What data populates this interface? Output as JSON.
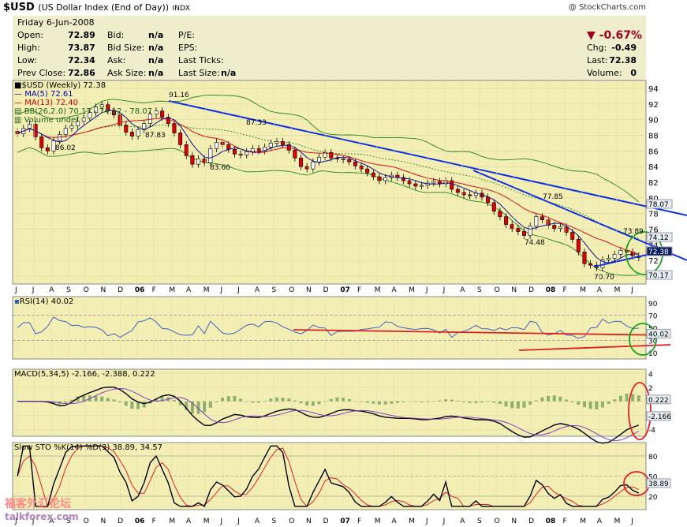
{
  "header": {
    "symbol": "$USD",
    "name": "(US Dollar Index (End of Day))",
    "exchange": "INDX",
    "copyright": "@ StockCharts.com"
  },
  "quote": {
    "date": "Friday   6-Jun-2008",
    "rows": [
      {
        "k1": "Open:",
        "v1": "72.89",
        "k2": "Bid:",
        "v2": "n/a",
        "k3": "P/E:"
      },
      {
        "k1": "High:",
        "v1": "73.87",
        "k2": "Bid Size:",
        "v2": "n/a",
        "k3": "EPS:"
      },
      {
        "k1": "Low:",
        "v1": "72.34",
        "k2": "Ask:",
        "v2": "n/a",
        "k3": "Last Ticks:"
      },
      {
        "k1": "Prev Close:",
        "v1": "72.86",
        "k2": "Ask Size:",
        "v2": "n/a",
        "k3": "Last Size:",
        "v3": "n/a"
      }
    ],
    "pct_change": "-0.67%",
    "right": [
      {
        "k": "Chg:",
        "v": "-0.49"
      },
      {
        "k": "Last:",
        "v": "72.38"
      },
      {
        "k": "Volume:",
        "v": "0"
      }
    ]
  },
  "legend": {
    "main": "$USD (Weekly) 72.38",
    "ma5": "MA(5) 72.61",
    "ma13": "MA(13) 72.40",
    "bb": "BB(26,2.0) 70.17 - 74.12 - 78.07",
    "vol": "Volume undef",
    "rsi": "RSI(14) 40.02",
    "macd": "MACD(5,34,5) -2.166, -2.388, 0.222",
    "sto": "Slow STO %K(14) %D(3) 38.89, 34.57"
  },
  "watermark": {
    "cn": "福客外汇论坛",
    "en": "talkforex.com"
  },
  "chart_data": [
    {
      "type": "candlestick",
      "title": "$USD (Weekly) 72.38",
      "x_labels": [
        "J",
        "J",
        "A",
        "S",
        "O",
        "N",
        "D",
        "06",
        "F",
        "M",
        "A",
        "M",
        "J",
        "J",
        "A",
        "S",
        "O",
        "N",
        "D",
        "07",
        "F",
        "M",
        "A",
        "M",
        "J",
        "J",
        "A",
        "S",
        "O",
        "N",
        "D",
        "08",
        "F",
        "M",
        "A",
        "M",
        "J"
      ],
      "y_ticks": [
        70,
        72,
        74,
        76,
        78,
        80,
        82,
        84,
        86,
        88,
        90,
        92,
        94
      ],
      "ylim": [
        69,
        95
      ],
      "annotations": [
        "86.02",
        "91.16",
        "87.83",
        "83.60",
        "87.33",
        "77.85",
        "74.48",
        "73.89",
        "70.70"
      ],
      "right_labels": [
        "78.07",
        "74.12",
        "72.38",
        "70.17"
      ],
      "close": [
        88.2,
        88.9,
        89.4,
        87.8,
        86.4,
        86.0,
        87.3,
        88.1,
        88.9,
        89.2,
        89.8,
        90.2,
        90.9,
        91.6,
        91.9,
        91.1,
        90.6,
        89.3,
        88.4,
        87.9,
        88.7,
        89.5,
        90.7,
        91.1,
        90.3,
        89.5,
        88.3,
        86.8,
        85.4,
        84.3,
        85.0,
        84.5,
        86.3,
        87.1,
        86.8,
        86.2,
        85.6,
        85.5,
        85.9,
        86.3,
        86.0,
        86.5,
        87.0,
        87.2,
        86.8,
        86.1,
        85.1,
        84.0,
        83.7,
        84.6,
        85.2,
        85.8,
        85.1,
        85.0,
        84.9,
        84.6,
        84.1,
        83.7,
        83.2,
        82.7,
        82.2,
        82.6,
        82.9,
        82.6,
        82.2,
        81.8,
        81.5,
        81.6,
        81.9,
        82.1,
        81.8,
        82.2,
        81.1,
        80.7,
        80.4,
        80.3,
        80.6,
        80.1,
        79.4,
        78.3,
        77.6,
        76.6,
        76.1,
        75.7,
        75.2,
        76.4,
        77.6,
        77.2,
        76.5,
        76.1,
        76.3,
        75.6,
        74.7,
        73.1,
        71.6,
        71.4,
        71.1,
        72.1,
        72.3,
        72.8,
        73.3,
        73.1,
        72.6,
        72.38
      ],
      "series": [
        {
          "name": "MA(5)",
          "last": 72.61
        },
        {
          "name": "MA(13)",
          "last": 72.4
        },
        {
          "name": "BB(26,2.0)",
          "values": [
            70.17,
            74.12,
            78.07
          ]
        }
      ]
    },
    {
      "type": "line",
      "title": "RSI(14) 40.02",
      "y_ticks": [
        10,
        30,
        50,
        70,
        90
      ],
      "ylim": [
        0,
        100
      ],
      "right_labels": [
        "40.02"
      ]
    },
    {
      "type": "line",
      "title": "MACD(5,34,5) -2.166, -2.388, 0.222",
      "y_ticks": [
        4,
        2,
        0,
        -2,
        -4
      ],
      "ylim": [
        -5,
        4.6
      ],
      "right_labels": [
        "0.222",
        "-2.166"
      ]
    },
    {
      "type": "line",
      "title": "Slow STO %K(14) %D(3) 38.89, 34.57",
      "y_ticks": [
        20,
        50,
        80
      ],
      "ylim": [
        0,
        100
      ],
      "right_labels": [
        "38.89"
      ]
    }
  ]
}
